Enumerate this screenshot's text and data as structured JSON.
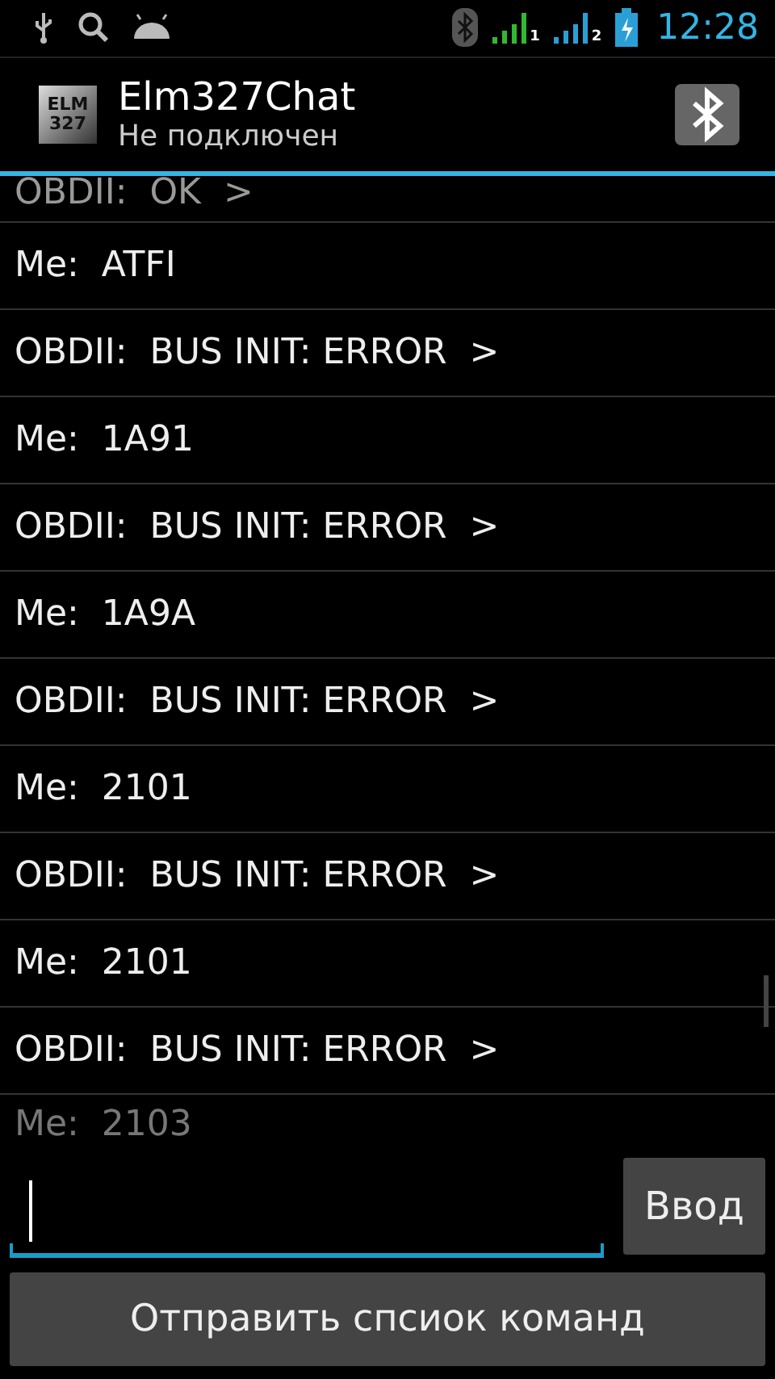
{
  "status_bar": {
    "time": "12:28",
    "sims": [
      {
        "label": "1",
        "color": "#33b833"
      },
      {
        "label": "2",
        "color": "#2a9fd6"
      }
    ]
  },
  "action_bar": {
    "logo_lines": [
      "ELM",
      "327"
    ],
    "title": "Elm327Chat",
    "subtitle": "Не подключен"
  },
  "messages": [
    {
      "text": "OBDII:  OK  >",
      "faded": true
    },
    {
      "text": "Me:  ATFI"
    },
    {
      "text": "OBDII:  BUS INIT: ERROR  >"
    },
    {
      "text": "Me:  1A91"
    },
    {
      "text": "OBDII:  BUS INIT: ERROR  >"
    },
    {
      "text": "Me:  1A9A"
    },
    {
      "text": "OBDII:  BUS INIT: ERROR  >"
    },
    {
      "text": "Me:  2101"
    },
    {
      "text": "OBDII:  BUS INIT: ERROR  >"
    },
    {
      "text": "Me:  2101"
    },
    {
      "text": "OBDII:  BUS INIT: ERROR  >"
    },
    {
      "text": "Me:  2103",
      "faded": true
    }
  ],
  "input": {
    "focused": true
  },
  "enter_button": "Ввод",
  "send_list_button": "Отправить спсиок команд"
}
